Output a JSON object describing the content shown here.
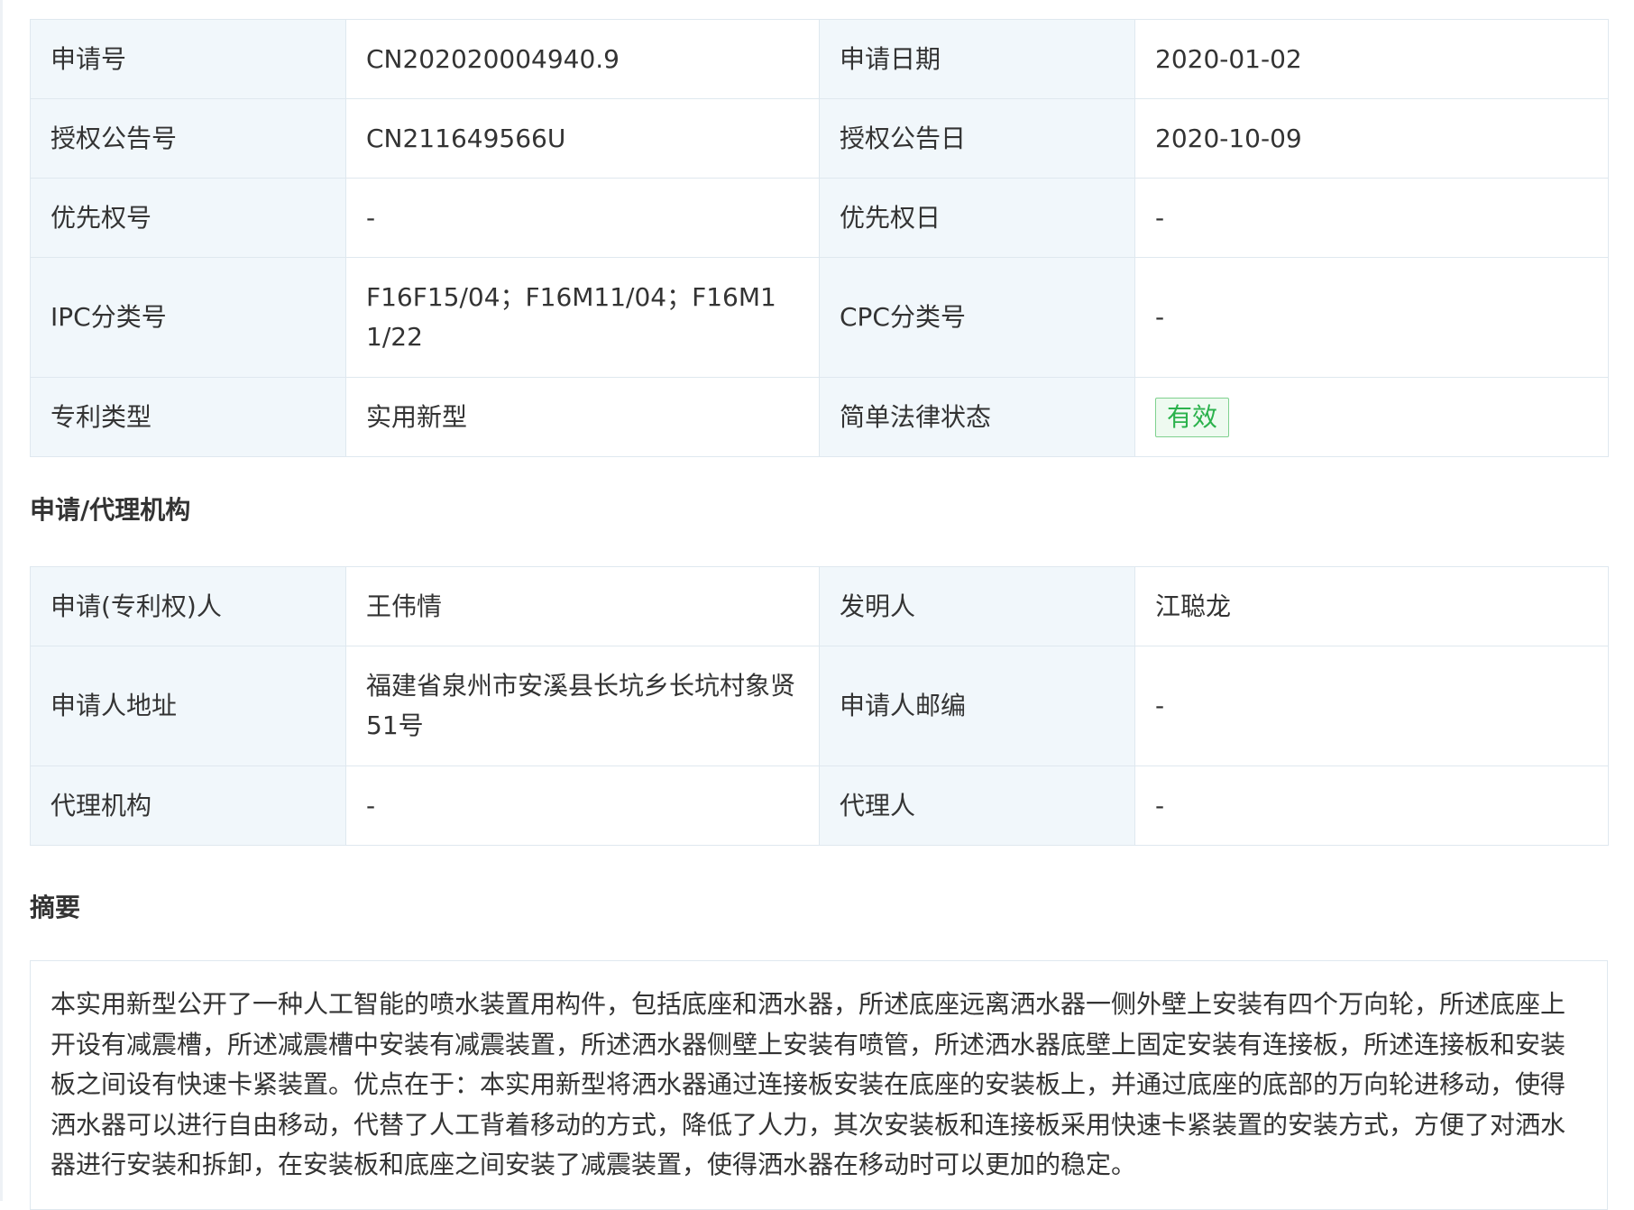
{
  "basic_info": {
    "rows": [
      {
        "k1": "申请号",
        "v1": "CN202020004940.9",
        "k2": "申请日期",
        "v2": "2020-01-02"
      },
      {
        "k1": "授权公告号",
        "v1": "CN211649566U",
        "k2": "授权公告日",
        "v2": "2020-10-09"
      },
      {
        "k1": "优先权号",
        "v1": "-",
        "k2": "优先权日",
        "v2": "-"
      },
      {
        "k1": "IPC分类号",
        "v1": "F16F15/04；F16M11/04；F16M11/22",
        "k2": "CPC分类号",
        "v2": "-"
      },
      {
        "k1": "专利类型",
        "v1": "实用新型",
        "k2": "简单法律状态",
        "v2": "有效"
      }
    ],
    "status_color": "#2bb24c"
  },
  "agency_section": {
    "title": "申请/代理机构",
    "rows": [
      {
        "k1": "申请(专利权)人",
        "v1": "王伟情",
        "k2": "发明人",
        "v2": "江聪龙"
      },
      {
        "k1": "申请人地址",
        "v1": "福建省泉州市安溪县长坑乡长坑村象贤51号",
        "k2": "申请人邮编",
        "v2": "-"
      },
      {
        "k1": "代理机构",
        "v1": "-",
        "k2": "代理人",
        "v2": "-"
      }
    ]
  },
  "abstract_section": {
    "title": "摘要",
    "text": "本实用新型公开了一种人工智能的喷水装置用构件，包括底座和洒水器，所述底座远离洒水器一侧外壁上安装有四个万向轮，所述底座上开设有减震槽，所述减震槽中安装有减震装置，所述洒水器侧壁上安装有喷管，所述洒水器底壁上固定安装有连接板，所述连接板和安装板之间设有快速卡紧装置。优点在于：本实用新型将洒水器通过连接板安装在底座的安装板上，并通过底座的底部的万向轮进移动，使得洒水器可以进行自由移动，代替了人工背着移动的方式，降低了人力，其次安装板和连接板采用快速卡紧装置的安装方式，方便了对洒水器进行安装和拆卸，在安装板和底座之间安装了减震装置，使得洒水器在移动时可以更加的稳定。"
  }
}
